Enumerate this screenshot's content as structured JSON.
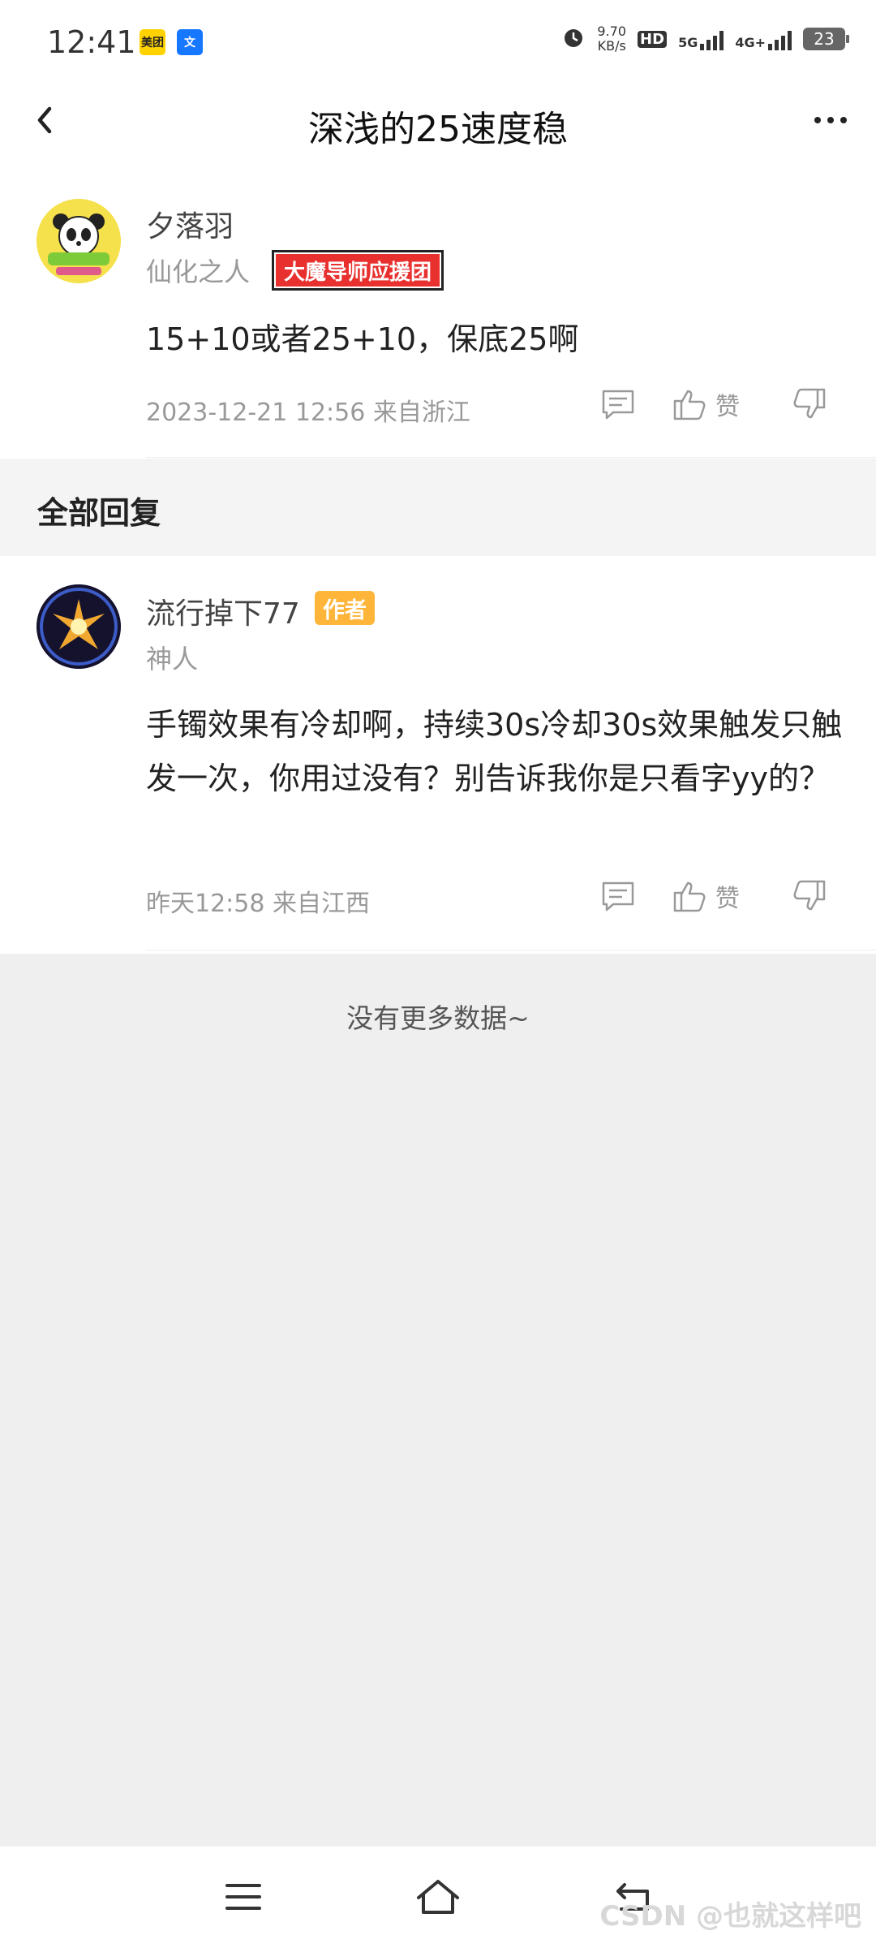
{
  "status_bar": {
    "time": "12:41",
    "apps": [
      "美团",
      "文"
    ],
    "net_speed": "9.70",
    "net_unit": "KB/s",
    "hd_label": "HD",
    "net5g": "5G",
    "net4g": "4G+",
    "battery": "23"
  },
  "header": {
    "title": "深浅的25速度稳"
  },
  "post": {
    "author": "夕落羽",
    "author_title": "仙化之人",
    "badge": "大魔导师应援团",
    "content": "15+10或者25+10，保底25啊",
    "time_location": "2023-12-21 12:56  来自浙江",
    "like_label": "赞"
  },
  "section": {
    "title": "全部回复"
  },
  "reply": {
    "author": "流行掉下77",
    "author_badge": "作者",
    "author_title": "神人",
    "content": "手镯效果有冷却啊，持续30s冷却30s效果触发只触发一次，你用过没有？别告诉我你是只看字yy的？",
    "time_location": "昨天12:58 来自江西",
    "like_label": "赞"
  },
  "no_more_text": "没有更多数据~",
  "watermark": "CSDN @也就这样吧",
  "colors": {
    "badge_red": "#e8312f",
    "author_badge": "#ffb53a",
    "background": "#efefef"
  }
}
